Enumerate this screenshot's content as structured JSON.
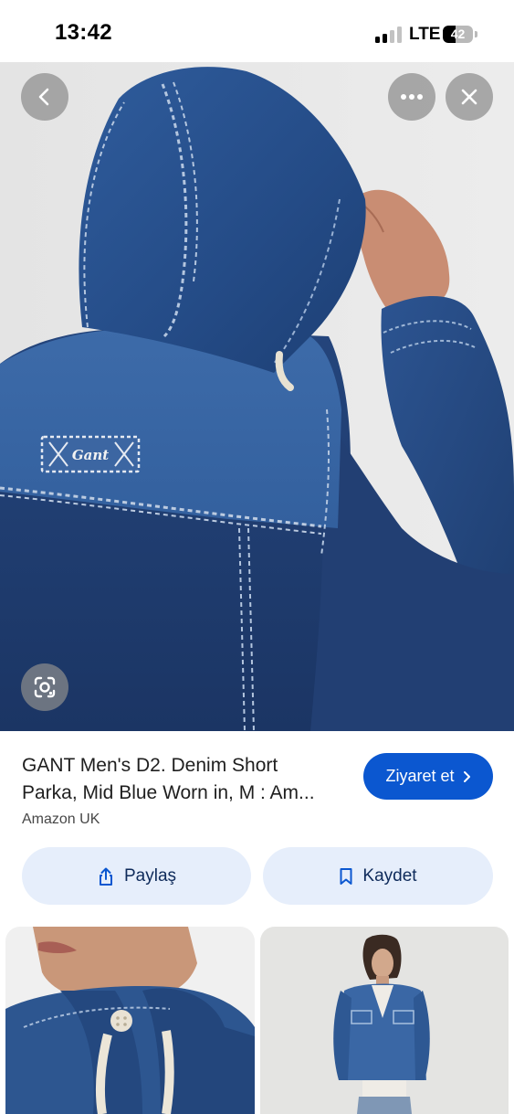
{
  "status_bar": {
    "time": "13:42",
    "network": "LTE",
    "battery_percent": "42",
    "battery_level": 0.42,
    "signal_bars_active": 2
  },
  "viewer": {
    "back_icon": "chevron-left-icon",
    "more_icon": "more-horizontal-icon",
    "close_icon": "close-icon",
    "lens_icon": "google-lens-icon",
    "patch_text": "Gant"
  },
  "product": {
    "title_line1": "GANT Men's D2. Denim Short",
    "title_line2": "Parka, Mid Blue Worn in, M : Am...",
    "source": "Amazon UK",
    "visit_label": "Ziyaret et",
    "visit_icon": "chevron-right-icon",
    "share_label": "Paylaş",
    "share_icon": "share-icon",
    "save_label": "Kaydet",
    "save_icon": "bookmark-icon"
  },
  "colors": {
    "accent": "#0b57d0",
    "pill_background": "#e6eefb",
    "pill_text": "#0e2a5a",
    "denim_light": "#3865a3",
    "denim_dark": "#1f3f72"
  }
}
